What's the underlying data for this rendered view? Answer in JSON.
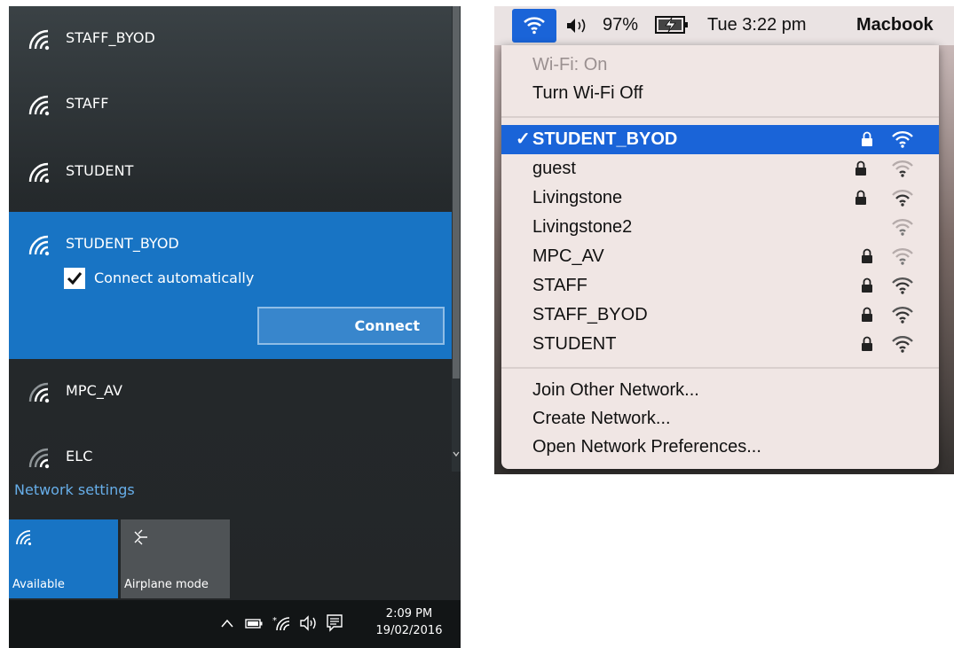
{
  "windows": {
    "networks": [
      {
        "name": "STAFF_BYOD"
      },
      {
        "name": "STAFF"
      },
      {
        "name": "STUDENT"
      },
      {
        "name": "STUDENT_BYOD"
      },
      {
        "name": "MPC_AV"
      },
      {
        "name": "ELC"
      }
    ],
    "selected": {
      "name": "STUDENT_BYOD",
      "connect_automatically_label": "Connect automatically",
      "connect_automatically_checked": true,
      "connect_button": "Connect"
    },
    "network_settings_link": "Network settings",
    "quick_actions": [
      {
        "label": "Available",
        "icon": "wifi-icon",
        "active": true
      },
      {
        "label": "Airplane mode",
        "icon": "airplane-icon",
        "active": false
      }
    ],
    "taskbar": {
      "time": "2:09 PM",
      "date": "19/02/2016"
    },
    "colors": {
      "accent": "#1874c4",
      "link": "#67aee9",
      "panel_bg": "#202426"
    }
  },
  "mac": {
    "menubar": {
      "battery_percent": "97%",
      "clock": "Tue 3:22 pm",
      "user": "Macbook"
    },
    "wifi_status": "Wi-Fi: On",
    "turn_off": "Turn Wi-Fi Off",
    "selected_network": "STUDENT_BYOD",
    "checkmark": "✓",
    "networks": [
      {
        "name": "STUDENT_BYOD",
        "locked": true,
        "selected": true
      },
      {
        "name": "guest",
        "locked": true,
        "selected": false
      },
      {
        "name": "Livingstone",
        "locked": true,
        "selected": false
      },
      {
        "name": "Livingstone2",
        "locked": false,
        "selected": false
      },
      {
        "name": "MPC_AV",
        "locked": true,
        "selected": false
      },
      {
        "name": "STAFF",
        "locked": true,
        "selected": false
      },
      {
        "name": "STAFF_BYOD",
        "locked": true,
        "selected": false
      },
      {
        "name": "STUDENT",
        "locked": true,
        "selected": false
      }
    ],
    "actions": {
      "join_other": "Join Other Network...",
      "create": "Create Network...",
      "preferences": "Open Network Preferences..."
    },
    "colors": {
      "highlight": "#1a64d8",
      "menu_bg": "#f0e6e4"
    }
  }
}
